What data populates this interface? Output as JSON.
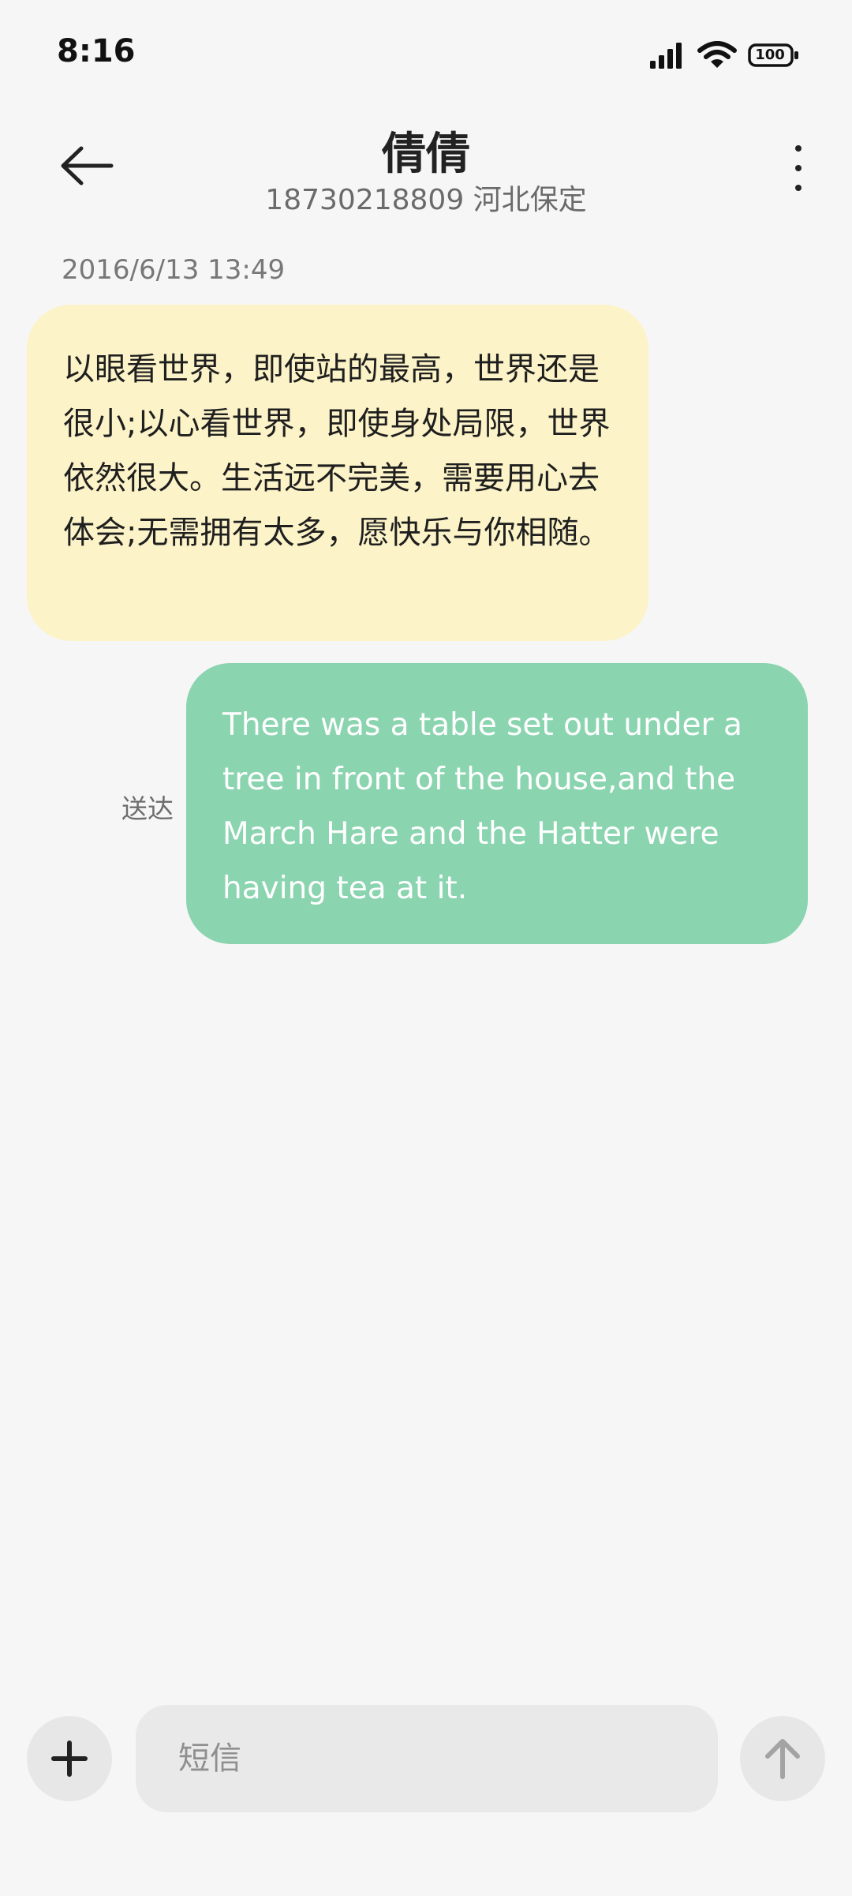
{
  "status_bar": {
    "time": "8:16",
    "battery": "100",
    "icons": [
      "signal-icon",
      "wifi-icon",
      "battery-icon"
    ]
  },
  "header": {
    "contact_name": "倩倩",
    "contact_detail": "18730218809 河北保定",
    "back_icon": "back-arrow-icon",
    "more_icon": "more-vertical-icon"
  },
  "conversation": {
    "timestamp": "2016/6/13 13:49",
    "messages": [
      {
        "direction": "incoming",
        "text": "以眼看世界，即使站的最高，世界还是很小;以心看世界，即使身处局限，世界依然很大。生活远不完美，需要用心去体会;无需拥有太多，愿快乐与你相随。"
      },
      {
        "direction": "outgoing",
        "text": "There was a table set out under a tree in front of the house,and the March Hare and the Hatter were having tea at it.",
        "status": "送达"
      }
    ]
  },
  "composer": {
    "placeholder": "短信",
    "add_icon": "plus-icon",
    "send_icon": "arrow-up-icon"
  },
  "colors": {
    "background": "#f6f6f6",
    "incoming_bubble": "#fcf3c8",
    "outgoing_bubble": "#8bd4b0",
    "input_background": "#e9e9e9"
  }
}
